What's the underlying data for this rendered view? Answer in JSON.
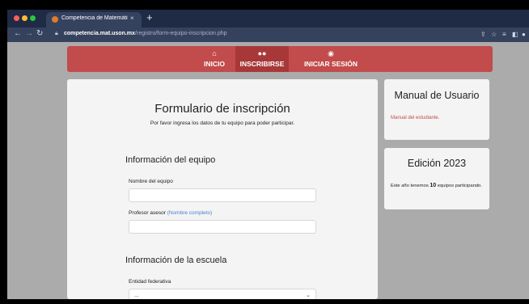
{
  "browser": {
    "tab_title": "Competencia de Matemáticas",
    "tab_close": "×",
    "new_tab": "+",
    "url_host": "competencia.mat.uson.mx",
    "url_path": "/registro/form-equipo-inscripcion.php",
    "colors": {
      "tabstrip": "#1f2a44",
      "toolbar": "#35425e"
    }
  },
  "navbar": {
    "color": "#c24b4b",
    "items": [
      {
        "label": "INICIO",
        "icon": "home-icon"
      },
      {
        "label": "INSCRIBIRSE",
        "icon": "users-icon",
        "active": true
      },
      {
        "label": "INICIAR SESIÓN",
        "icon": "user-circle-icon"
      }
    ]
  },
  "form": {
    "title": "Formulario de inscripción",
    "subtitle": "Por favor ingresa los datos de tu equipo para poder participar.",
    "team_section": "Información del equipo",
    "team_name_label": "Nombre del equipo",
    "team_name_value": "",
    "advisor_label": "Profesor asesor",
    "advisor_hint": "(Nombre completo)",
    "advisor_value": "",
    "school_section": "Información de la escuela",
    "state_label": "Entidad federativa",
    "state_value": "..."
  },
  "sidebar": {
    "manual": {
      "title": "Manual de Usuario",
      "link": "Manual del estudiante",
      "link_suffix": "."
    },
    "edition": {
      "title": "Edición 2023",
      "text_before": "Este año tenemos",
      "count": "10",
      "text_after": "equipos participando."
    }
  }
}
